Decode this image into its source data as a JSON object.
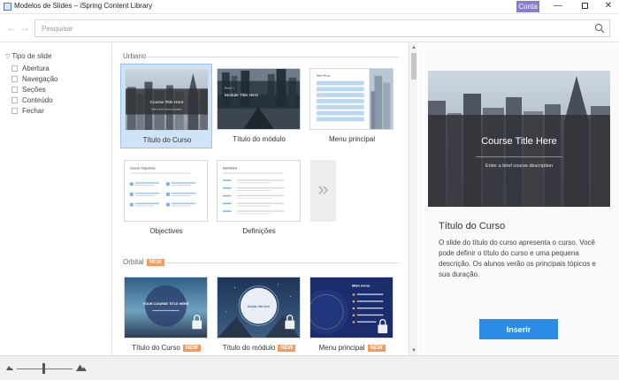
{
  "window": {
    "title": "Modelos de Slides – iSpring Content Library",
    "account_button": "Conta",
    "minimize_glyph": "—",
    "close_glyph": "✕"
  },
  "search": {
    "placeholder": "Pesquisar",
    "value": ""
  },
  "nav": {
    "back_glyph": "←",
    "forward_glyph": "→"
  },
  "sidebar": {
    "filter_title": "Tipo de slide",
    "items": [
      {
        "label": "Abertura",
        "checked": false
      },
      {
        "label": "Navegação",
        "checked": false
      },
      {
        "label": "Seções",
        "checked": false
      },
      {
        "label": "Conteúdo",
        "checked": false
      },
      {
        "label": "Fechar",
        "checked": false
      }
    ]
  },
  "gallery": {
    "sections": [
      {
        "name": "Urbano",
        "new": false,
        "cards": [
          {
            "label": "Título do Curso",
            "selected": true,
            "new": false,
            "thumb_title": "Course Title Here",
            "thumb_sub": "Enter a brief course description"
          },
          {
            "label": "Título do módulo",
            "selected": false,
            "new": false,
            "thumb_kicker": "Module 1",
            "thumb_title": "Module Title Here"
          },
          {
            "label": "Menu principal",
            "selected": false,
            "new": false,
            "thumb_title": "Main Menu"
          },
          {
            "label": "Objectives",
            "selected": false,
            "new": false,
            "thumb_title": "Course Objectives"
          },
          {
            "label": "Definições",
            "selected": false,
            "new": false,
            "thumb_title": "Definitions"
          }
        ],
        "more_glyph": "»"
      },
      {
        "name": "Orbital",
        "new": true,
        "new_label": "NEW",
        "cards": [
          {
            "label": "Título do Curso",
            "new": true,
            "new_label": "NEW",
            "thumb_title": "YOUR COURSE TITLE HERE",
            "locked": true
          },
          {
            "label": "Título do módulo",
            "new": true,
            "new_label": "NEW",
            "thumb_title": "Module title here",
            "locked": true
          },
          {
            "label": "Menu principal",
            "new": true,
            "new_label": "NEW",
            "thumb_title": "Main menu",
            "locked": true
          }
        ]
      }
    ]
  },
  "preview": {
    "image_title": "Course Title Here",
    "image_subtitle": "Enter a brief course description",
    "title": "Título do Curso",
    "description": "O slide do título do curso apresenta o curso. Você pode definir o título do curso e uma pequena descrição. Os alunos verão os principais tópicos e sua duração.",
    "insert_button": "Inserir"
  },
  "zoom": {
    "level": 0.48
  },
  "colors": {
    "accent": "#2b8ce6",
    "account": "#8b7dc8",
    "new_badge": "#f39a5c",
    "selection": "#cfe3f7"
  }
}
